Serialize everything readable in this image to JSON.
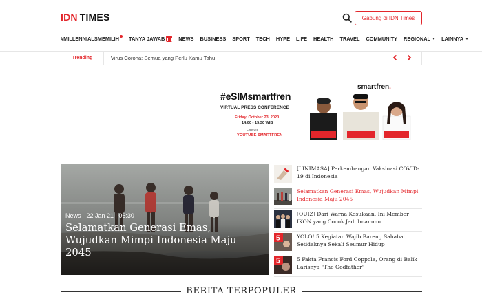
{
  "header": {
    "logo_idn": "IDN",
    "logo_times": "TIMES",
    "join_label": "Gabung di IDN Times",
    "nav": [
      {
        "label": "#MILLENNIALSMEMILIH",
        "marker": "dot"
      },
      {
        "label": "TANYA JAWAB",
        "marker": "badge"
      },
      {
        "label": "NEWS"
      },
      {
        "label": "BUSINESS"
      },
      {
        "label": "SPORT"
      },
      {
        "label": "TECH"
      },
      {
        "label": "HYPE"
      },
      {
        "label": "LIFE"
      },
      {
        "label": "HEALTH"
      },
      {
        "label": "TRAVEL"
      },
      {
        "label": "COMMUNITY"
      },
      {
        "label": "REGIONAL",
        "marker": "caret"
      },
      {
        "label": "LAINNYA",
        "marker": "caret"
      }
    ]
  },
  "trending": {
    "label": "Trending",
    "text": "Virus Corona: Semua yang Perlu Kamu Tahu"
  },
  "ad": {
    "hashtag": "#eSIMsmartfren",
    "subtitle": "VIRTUAL PRESS CONFERENCE",
    "date": "Friday, October 23, 2020",
    "time": "14.00 - 15.30 WIB",
    "live_on": "Live on",
    "channel": "YOUTUBE SMARTFREN",
    "brand": "smartfren",
    "brand_dot": "."
  },
  "hero": {
    "meta": "News · 22 Jan 21 | 06:30",
    "title": "Selamatkan Generasi Emas, Wujudkan Mimpi Indonesia Maju 2045"
  },
  "side_list": [
    {
      "title": "[LINIMASA] Perkembangan Vaksinasi COVID-19 di Indonesia",
      "active": false
    },
    {
      "title": "Selamatkan Generasi Emas, Wujudkan Mimpi Indonesia Maju 2045",
      "active": true
    },
    {
      "title": "[QUIZ] Dari Warna Kesukaan, Ini Member IKON yang Cocok Jadi Imammu",
      "active": false
    },
    {
      "title": "YOLO! 5 Kegiatan Wajib Bareng Sahabat, Setidaknya Sekali Seumur Hidup",
      "active": false
    },
    {
      "title": "5 Fakta Francis Ford Coppola, Orang di Balik Larisnya \"The Godfather\"",
      "active": false
    }
  ],
  "section": {
    "title": "BERITA TERPOPULER"
  },
  "icons": {
    "search": "search-icon",
    "prev": "chevron-left-icon",
    "next": "chevron-right-icon"
  },
  "colors": {
    "accent": "#e3262b",
    "text": "#222222",
    "border": "#e6e6e6"
  }
}
